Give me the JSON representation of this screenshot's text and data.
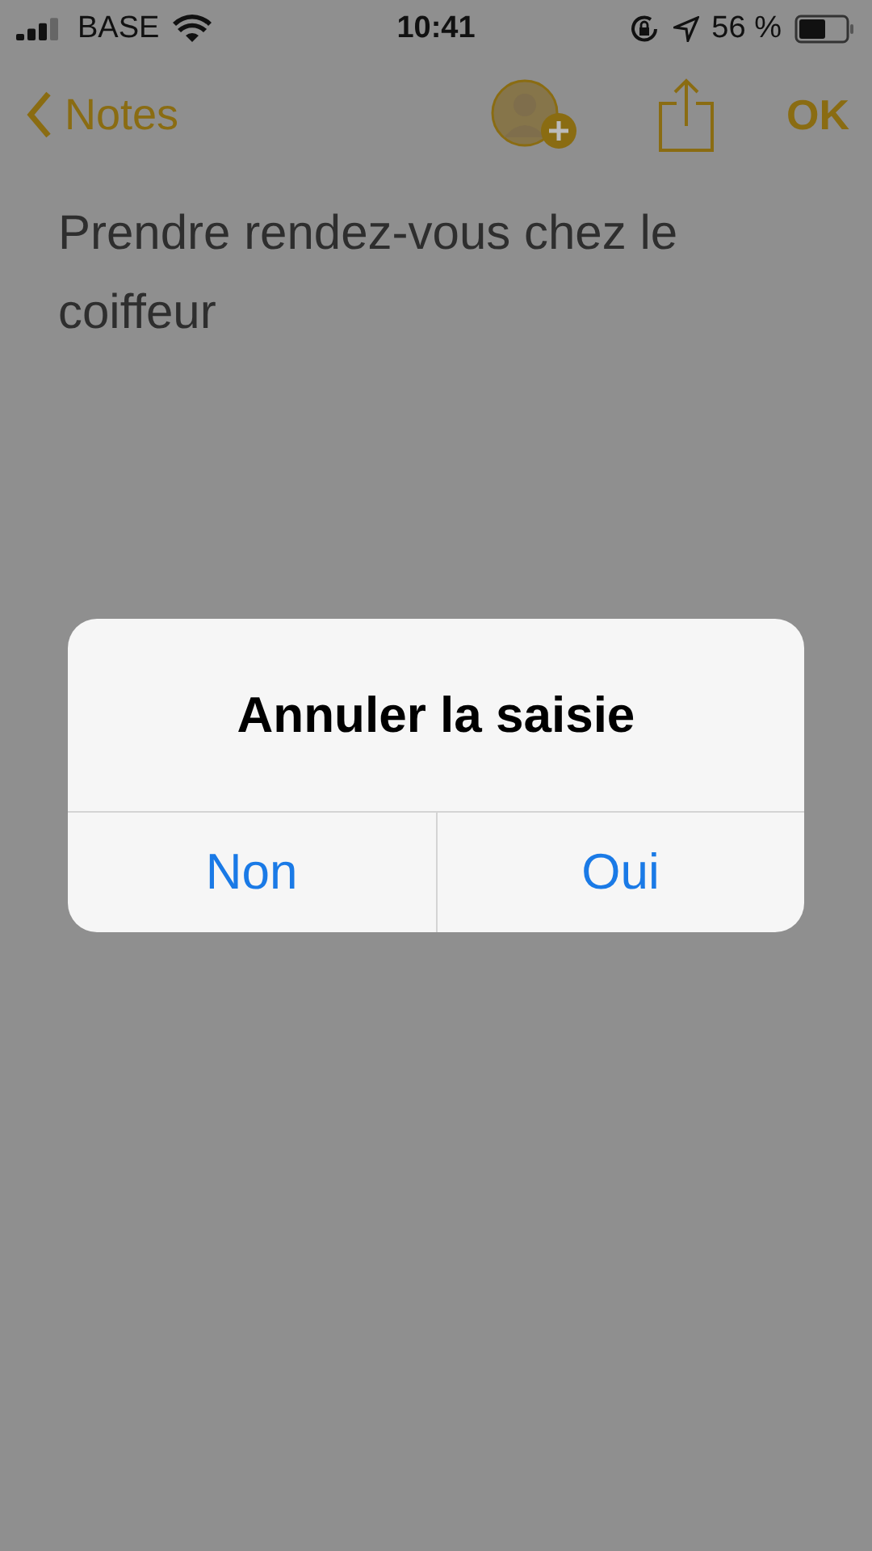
{
  "status_bar": {
    "carrier": "BASE",
    "time": "10:41",
    "battery": "56 %"
  },
  "nav_bar": {
    "back": "Notes",
    "done": "OK"
  },
  "note": {
    "text": "Prendre rendez-vous chez le coiffeur"
  },
  "alert": {
    "title": "Annuler la saisie",
    "buttons": [
      "Non",
      "Oui"
    ]
  }
}
